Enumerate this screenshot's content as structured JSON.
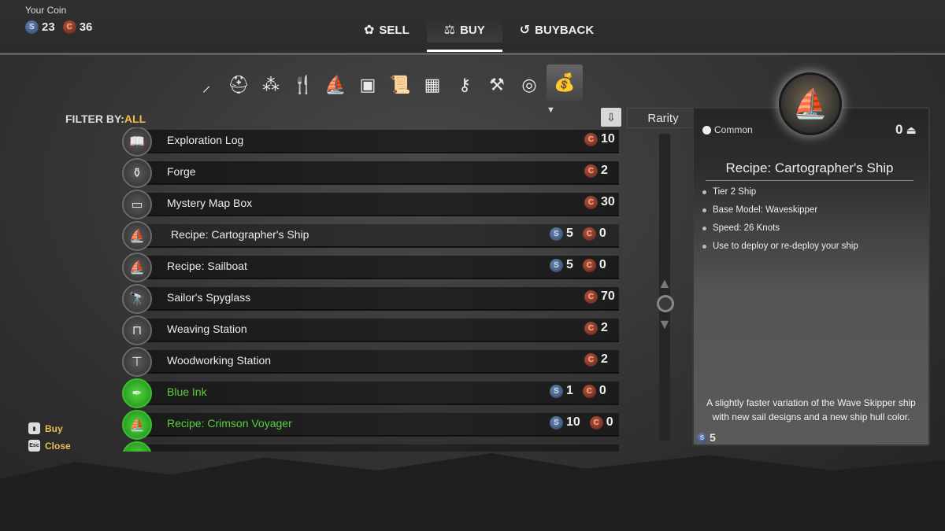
{
  "coins": {
    "title": "Your Coin",
    "silver": "23",
    "copper": "36"
  },
  "tabs": [
    {
      "label": "SELL",
      "icon": "sell-icon"
    },
    {
      "label": "BUY",
      "icon": "scales-icon"
    },
    {
      "label": "BUYBACK",
      "icon": "undo-icon"
    }
  ],
  "categories": [
    "sword-icon",
    "helmet-icon",
    "herbs-icon",
    "utensils-icon",
    "ship-icon",
    "frame-icon",
    "scroll-icon",
    "map-icon",
    "key-icon",
    "anvil-icon",
    "coins-icon",
    "money-bag-icon"
  ],
  "filter": {
    "label": "FILTER BY:",
    "value": "ALL"
  },
  "sort": {
    "rarity_label": "Rarity"
  },
  "items": [
    {
      "name": "Exploration Log",
      "silver": "",
      "copper": "10",
      "green": false
    },
    {
      "name": "Forge",
      "silver": "",
      "copper": "2",
      "green": false
    },
    {
      "name": "Mystery Map Box",
      "silver": "",
      "copper": "30",
      "green": false
    },
    {
      "name": "Recipe: Cartographer's Ship",
      "silver": "5",
      "copper": "0",
      "green": false
    },
    {
      "name": "Recipe: Sailboat",
      "silver": "5",
      "copper": "0",
      "green": false
    },
    {
      "name": "Sailor's Spyglass",
      "silver": "",
      "copper": "70",
      "green": false
    },
    {
      "name": "Weaving Station",
      "silver": "",
      "copper": "2",
      "green": false
    },
    {
      "name": "Woodworking Station",
      "silver": "",
      "copper": "2",
      "green": false
    },
    {
      "name": "Blue Ink",
      "silver": "1",
      "copper": "0",
      "green": true
    },
    {
      "name": "Recipe: Crimson Voyager",
      "silver": "10",
      "copper": "0",
      "green": true
    }
  ],
  "detail": {
    "rarity": "Common",
    "weight": "0",
    "title": "Recipe: Cartographer's Ship",
    "bullets": [
      "Tier 2 Ship",
      "Base Model: Waveskipper",
      "Speed: 26 Knots",
      "Use to deploy or re-deploy your ship"
    ],
    "description": "A slightly faster variation of the Wave Skipper ship with new sail designs and a new ship hull color.",
    "price": "5"
  },
  "prompts": {
    "buy": "Buy",
    "close": "Close",
    "close_key": "Esc"
  }
}
